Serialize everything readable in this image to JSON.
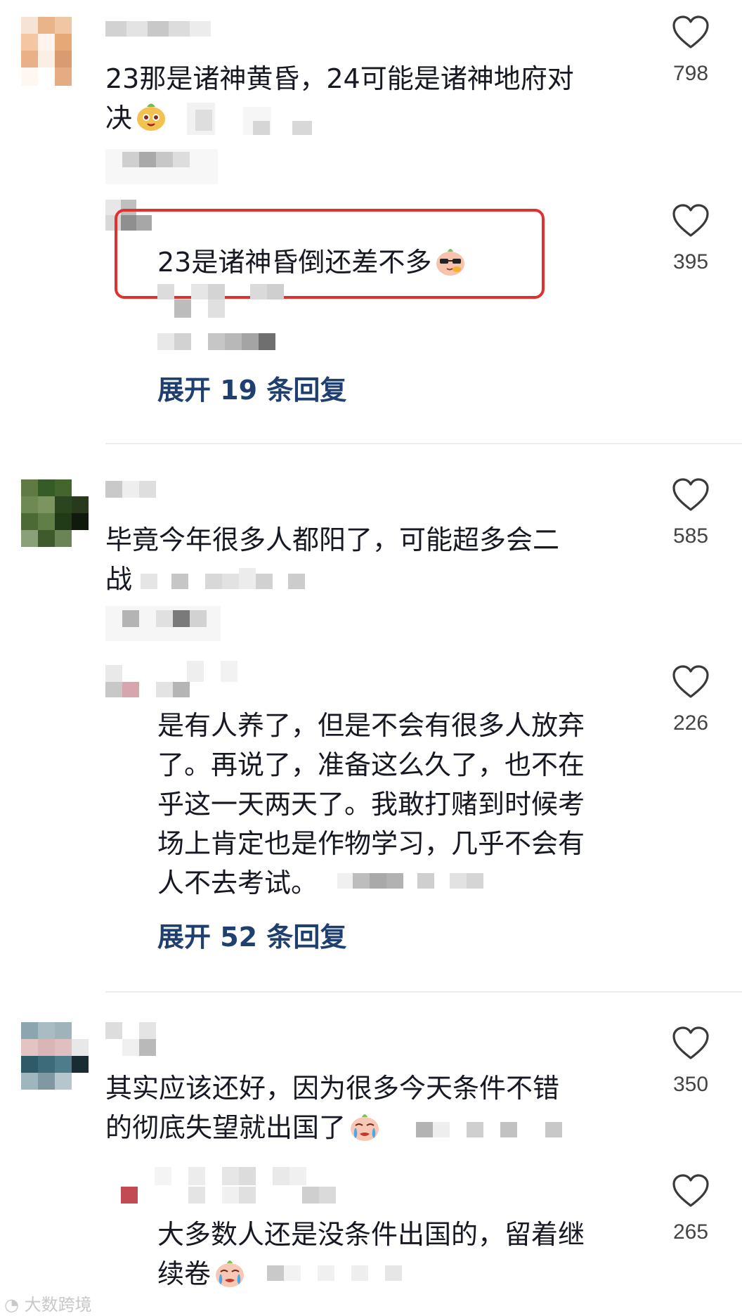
{
  "comments": [
    {
      "text_line1": "23那是诸神黄昏，24可能是诸神地府对",
      "text_line2": "决",
      "likes": "798",
      "reply": {
        "text_line1": "23是诸神昏倒还差不多",
        "likes": "395"
      },
      "expand_label": "展开 19 条回复"
    },
    {
      "text_line1": "毕竟今年很多人都阳了，可能超多会二",
      "text_line2": "战",
      "likes": "585",
      "reply": {
        "text_line1": "是有人养了，但是不会有很多人放弃",
        "text_line2": "了。再说了，准备这么久了，也不在",
        "text_line3": "乎这一天两天了。我敢打赌到时候考",
        "text_line4": "场上肯定也是作物学习，几乎不会有",
        "text_line5": "人不去考试。",
        "likes": "226"
      },
      "expand_label": "展开 52 条回复"
    },
    {
      "text_line1": "其实应该还好，因为很多今天条件不错",
      "text_line2": "的彻底失望就出国了",
      "likes": "350",
      "reply": {
        "text_line1": "大多数人还是没条件出国的，留着继",
        "text_line2": "续卷",
        "likes": "265"
      }
    }
  ],
  "watermark": "大数跨境",
  "icons": {
    "like": "heart-outline-icon"
  },
  "colors": {
    "text": "#161823",
    "link": "#1f3f6f",
    "highlight": "#e03030",
    "like_count": "#444444"
  }
}
